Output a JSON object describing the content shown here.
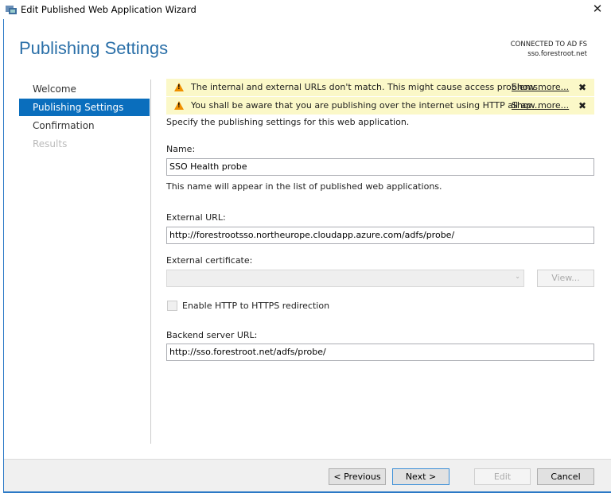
{
  "window": {
    "title": "Edit Published Web Application Wizard",
    "close": "✕"
  },
  "header": {
    "title": "Publishing Settings",
    "connection_label": "CONNECTED TO AD FS",
    "connection_server": "sso.forestroot.net"
  },
  "nav": [
    {
      "label": "Welcome"
    },
    {
      "label": "Publishing Settings"
    },
    {
      "label": "Confirmation"
    },
    {
      "label": "Results"
    }
  ],
  "warnings": [
    {
      "text": "The internal and external URLs don't match. This might cause access problems.",
      "link": "Show more...",
      "close": "✖"
    },
    {
      "text": "You shall be aware that you are publishing over the internet using HTTP all ap...",
      "link": "Show more...",
      "close": "✖"
    }
  ],
  "form": {
    "intro": "Specify the publishing settings for this web application.",
    "name_label": "Name:",
    "name_value": "SSO Health probe",
    "name_hint": "This name will appear in the list of published web applications.",
    "external_url_label": "External URL:",
    "external_url_value": "http://forestrootsso.northeurope.cloudapp.azure.com/adfs/probe/",
    "cert_label": "External certificate:",
    "cert_value": "",
    "view_button": "View...",
    "redirect_label": "Enable HTTP to HTTPS redirection",
    "redirect_checked": false,
    "backend_label": "Backend server URL:",
    "backend_value": "http://sso.forestroot.net/adfs/probe/"
  },
  "footer": {
    "previous": "< Previous",
    "next": "Next >",
    "edit": "Edit",
    "cancel": "Cancel"
  }
}
